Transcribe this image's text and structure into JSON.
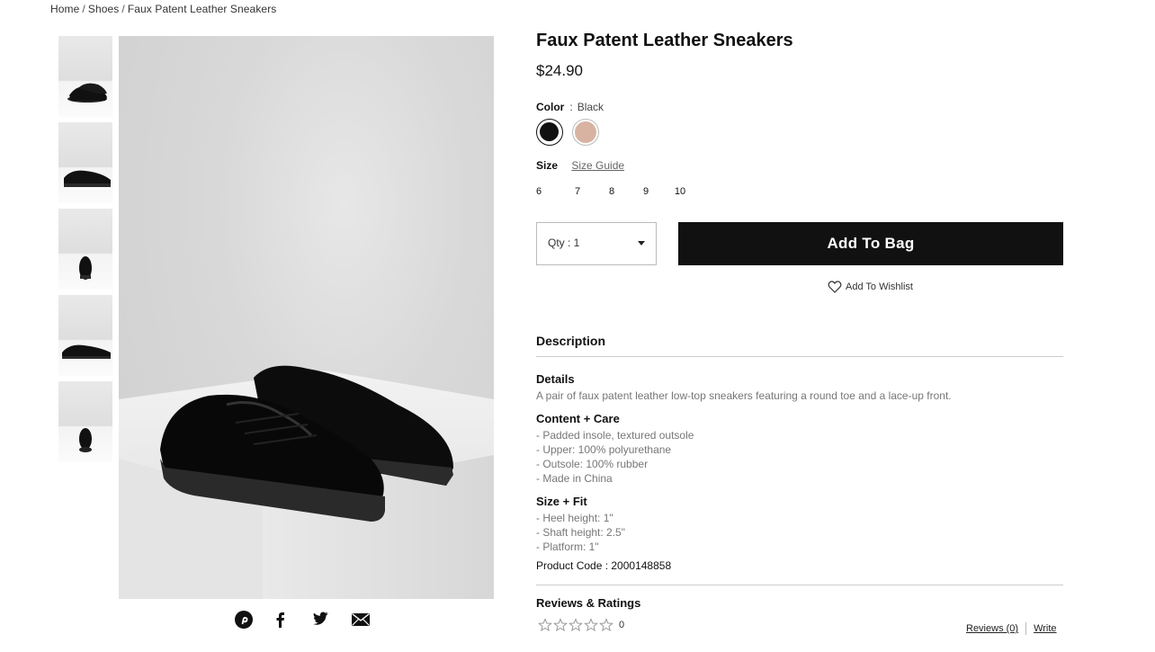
{
  "breadcrumb": {
    "home": "Home",
    "shoes": "Shoes",
    "current": "Faux Patent Leather Sneakers",
    "separator": "/"
  },
  "product": {
    "title": "Faux Patent Leather Sneakers",
    "price": "$24.90",
    "color_label": "Color",
    "color_separator": ":",
    "color_value": "Black",
    "swatches": [
      {
        "name": "Black",
        "hex": "#111111"
      },
      {
        "name": "Nude",
        "hex": "#d8b3a1"
      }
    ],
    "size_label": "Size",
    "size_guide": "Size Guide",
    "sizes": [
      "6",
      "7",
      "8",
      "9",
      "10"
    ],
    "qty_label": "Qty : 1",
    "add_to_bag": "Add To Bag",
    "wishlist": "Add To Wishlist"
  },
  "description": {
    "heading": "Description",
    "details_heading": "Details",
    "details_text": "A pair of faux patent leather low-top sneakers featuring a round toe and a lace-up front.",
    "content_heading": "Content + Care",
    "content_lines": [
      "- Padded insole, textured outsole",
      "- Upper: 100% polyurethane",
      "- Outsole: 100% rubber",
      "- Made in China"
    ],
    "fit_heading": "Size + Fit",
    "fit_lines": [
      "- Heel height: 1\"",
      "- Shaft height: 2.5\"",
      "- Platform: 1\""
    ],
    "product_code": "Product Code : 2000148858"
  },
  "reviews": {
    "heading": "Reviews & Ratings",
    "rating_count": "0",
    "reviews_link": "Reviews (0)",
    "write_link": "Write",
    "stars_filled": 0,
    "stars_total": 5
  },
  "share": [
    "pinterest-icon",
    "facebook-icon",
    "twitter-icon",
    "email-icon"
  ],
  "colors": {
    "button_bg": "#111111",
    "text_muted": "#777777",
    "divider": "#cccccc"
  }
}
